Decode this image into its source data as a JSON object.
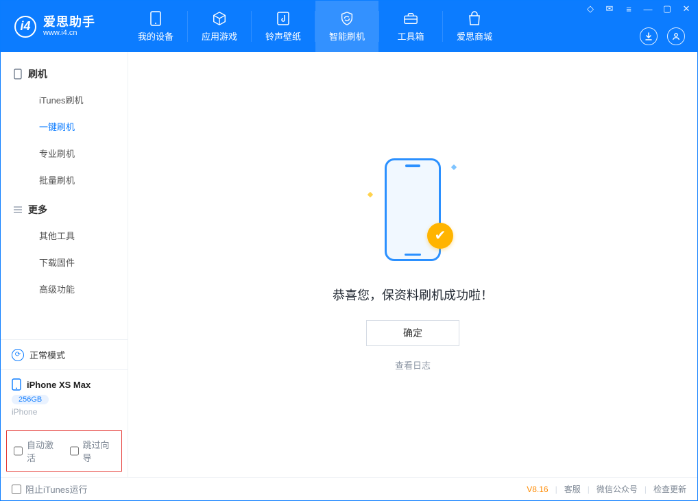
{
  "app": {
    "name_cn": "爱思助手",
    "url": "www.i4.cn"
  },
  "nav": {
    "items": [
      {
        "label": "我的设备"
      },
      {
        "label": "应用游戏"
      },
      {
        "label": "铃声壁纸"
      },
      {
        "label": "智能刷机"
      },
      {
        "label": "工具箱"
      },
      {
        "label": "爱思商城"
      }
    ],
    "active_index": 3
  },
  "sidebar": {
    "groups": [
      {
        "title": "刷机",
        "items": [
          {
            "label": "iTunes刷机"
          },
          {
            "label": "一键刷机"
          },
          {
            "label": "专业刷机"
          },
          {
            "label": "批量刷机"
          }
        ],
        "active_index": 1
      },
      {
        "title": "更多",
        "items": [
          {
            "label": "其他工具"
          },
          {
            "label": "下载固件"
          },
          {
            "label": "高级功能"
          }
        ],
        "active_index": -1
      }
    ],
    "mode": {
      "label": "正常模式"
    },
    "device": {
      "name": "iPhone XS Max",
      "storage": "256GB",
      "type": "iPhone"
    },
    "options": {
      "auto_activate": {
        "label": "自动激活",
        "checked": false
      },
      "skip_wizard": {
        "label": "跳过向导",
        "checked": false
      }
    }
  },
  "main": {
    "success_message": "恭喜您，保资料刷机成功啦！",
    "ok_button": "确定",
    "view_log": "查看日志"
  },
  "footer": {
    "block_itunes": {
      "label": "阻止iTunes运行",
      "checked": false
    },
    "version": "V8.16",
    "links": {
      "support": "客服",
      "wechat": "微信公众号",
      "update": "检查更新"
    }
  },
  "colors": {
    "primary": "#0c7cff",
    "accent": "#ffb400",
    "highlight_border": "#e53935"
  }
}
